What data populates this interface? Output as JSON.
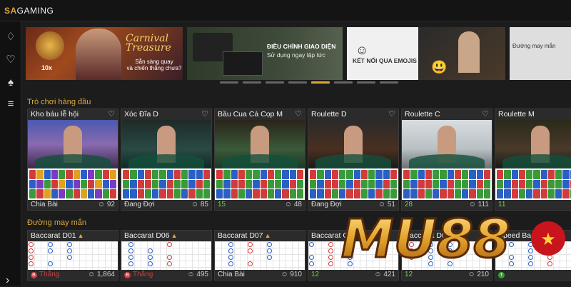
{
  "app": {
    "logo_prefix": "SA",
    "logo_suffix": "GAMING"
  },
  "sidebar": [
    "cards-chips-icon",
    "heart-icon",
    "playing-cards-icon",
    "chip-stack-icon"
  ],
  "banners": [
    {
      "title": "Carnival Treasure",
      "subtitle": "Sẵn sàng quay\nvà chiến thắng chưa?",
      "badge": "10x"
    },
    {
      "line1": "ĐIỀU CHỈNH GIAO DIỆN",
      "line2": "Sử dụng ngay lập tức"
    },
    {
      "line1": "KẾT NỐI QUA EMOJIS"
    },
    {
      "line1": "Đường may mắn"
    }
  ],
  "carousel": {
    "count": 8,
    "active": 4
  },
  "sections": {
    "top": "Trò chơi hàng đầu",
    "lucky": "Đường may mắn"
  },
  "top_games": [
    {
      "name": "Kho báu lễ hội",
      "status": "Chia Bài",
      "players": "92"
    },
    {
      "name": "Xóc Đĩa D",
      "status": "Đang Đợi",
      "players": "85"
    },
    {
      "name": "Bầu Cua Cá Cọp M",
      "status": "15",
      "players": "48"
    },
    {
      "name": "Roulette D",
      "status": "Đang Đợi",
      "players": "51"
    },
    {
      "name": "Roulette C",
      "status": "28",
      "players": "111"
    },
    {
      "name": "Roulette M",
      "status": "11",
      "players": ""
    }
  ],
  "lucky_games": [
    {
      "name": "Baccarat D01",
      "status": "Thắng",
      "badge": "B",
      "players": "1,864"
    },
    {
      "name": "Baccarat D06",
      "status": "Thắng",
      "badge": "B",
      "players": "495"
    },
    {
      "name": "Baccarat D07",
      "status": "Chia Bài",
      "badge": "",
      "players": "910"
    },
    {
      "name": "Baccarat C",
      "status": "12",
      "badge": "",
      "players": "421"
    },
    {
      "name": "Baccarat D07",
      "status": "12",
      "badge": "",
      "players": "210"
    },
    {
      "name": "Speed Baccarat",
      "status": "",
      "badge": "T",
      "players": ""
    }
  ],
  "watermark": {
    "text": "MU88"
  },
  "colors": {
    "accent": "#d9a93a",
    "bg": "#1c1c1c",
    "red": "#d23b3b",
    "blue": "#2b5fc4",
    "green": "#3a9a3a"
  }
}
